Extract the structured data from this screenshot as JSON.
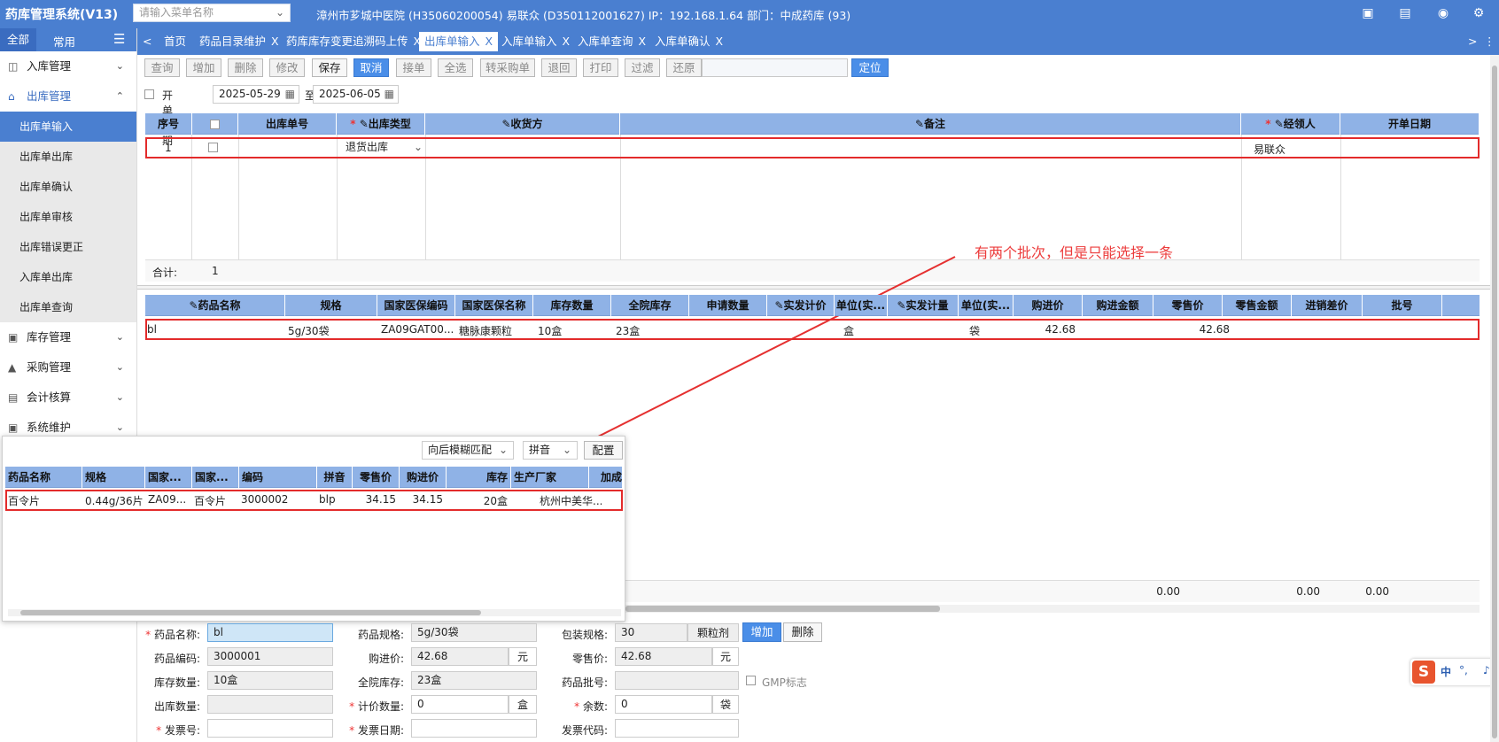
{
  "app_title": "药库管理系统(V13)",
  "menu_search": {
    "placeholder": "请输入菜单名称"
  },
  "system_info": "漳州市芗城中医院 (H35060200054) 易联众 (D350112001627) IP：192.168.1.64 部门：中成药库 (93)",
  "top_icons": [
    "monitor-icon",
    "document-icon",
    "eye-icon",
    "gear-icon"
  ],
  "nav_tabs": [
    "全部",
    "常用"
  ],
  "sidebar": {
    "groups": [
      {
        "label": "入库管理",
        "icon": "inbound-icon",
        "expanded": false
      },
      {
        "label": "出库管理",
        "icon": "outbound-icon",
        "expanded": true
      }
    ],
    "subitems": [
      "出库单输入",
      "出库单出库",
      "出库单确认",
      "出库单审核",
      "出库错误更正",
      "入库单出库",
      "出库单查询"
    ],
    "groups_after": [
      {
        "label": "库存管理",
        "icon": "stock-icon"
      },
      {
        "label": "采购管理",
        "icon": "purchase-icon"
      },
      {
        "label": "会计核算",
        "icon": "accounting-icon"
      },
      {
        "label": "系统维护",
        "icon": "system-icon"
      }
    ]
  },
  "tabs": [
    "首页",
    "药品目录维护",
    "药库库存变更追溯码上传",
    "出库单输入",
    "入库单输入",
    "入库单查询",
    "入库单确认"
  ],
  "active_tab": "出库单输入",
  "toolbar": [
    "查询",
    "增加",
    "删除",
    "修改",
    "保存",
    "取消",
    "接单",
    "全选",
    "转采购单",
    "退回",
    "打印",
    "过滤",
    "还原"
  ],
  "toolbar_enabled": [
    "保存"
  ],
  "toolbar_primary": "取消",
  "locate_button": "定位",
  "date_filter": {
    "label": "开单日期",
    "from": "2025-05-29",
    "sep": "至",
    "to": "2025-06-05"
  },
  "top_grid": {
    "headers": [
      "序号",
      "",
      "出库单号",
      "出库类型",
      "收货方",
      "备注",
      "经领人",
      "开单日期"
    ],
    "row": {
      "seq": "1",
      "type": "退货出库",
      "handler": "易联众"
    },
    "total_label": "合计:",
    "total_value": "1"
  },
  "annotation": "有两个批次，但是只能选择一条",
  "detail_grid": {
    "headers": [
      "药品名称",
      "规格",
      "国家医保编码",
      "国家医保名称",
      "库存数量",
      "全院库存",
      "申请数量",
      "实发计价",
      "单位(实...",
      "实发计量",
      "单位(实...",
      "购进价",
      "购进金额",
      "零售价",
      "零售金额",
      "进销差价",
      "批号"
    ],
    "row": [
      "bl",
      "5g/30袋",
      "ZA09GAT00...",
      "糖脉康颗粒",
      "10盒",
      "23盒",
      "",
      "",
      "盒",
      "",
      "袋",
      "42.68",
      "",
      "42.68",
      "",
      "",
      ""
    ],
    "totals": {
      "purchase_amount": "0.00",
      "retail_amount": "0.00",
      "diff": "0.00"
    }
  },
  "popup": {
    "match_mode": "向后模糊匹配",
    "input_mode": "拼音",
    "config_button": "配置",
    "headers": [
      "药品名称",
      "规格",
      "国家...",
      "国家...",
      "编码",
      "拼音",
      "零售价",
      "购进价",
      "库存",
      "生产厂家",
      "加成"
    ],
    "row": [
      "百令片",
      "0.44g/36片",
      "ZA09...",
      "百令片",
      "3000002",
      "blp",
      "34.15",
      "34.15",
      "20盒",
      "杭州中美华..."
    ]
  },
  "form": {
    "drug_name": {
      "label": "药品名称",
      "value": "bl"
    },
    "spec": {
      "label": "药品规格",
      "value": "5g/30袋"
    },
    "package": {
      "label": "包装规格",
      "value": "30",
      "unit": "颗粒剂"
    },
    "code": {
      "label": "药品编码",
      "value": "3000001"
    },
    "purchase_price": {
      "label": "购进价",
      "value": "42.68",
      "unit": "元"
    },
    "retail_price": {
      "label": "零售价",
      "value": "42.68",
      "unit": "元"
    },
    "stock_qty": {
      "label": "库存数量",
      "value": "10盒"
    },
    "hospital_stock": {
      "label": "全院库存",
      "value": "23盒"
    },
    "batch": {
      "label": "药品批号",
      "value": ""
    },
    "gmp": "GMP标志",
    "out_qty": {
      "label": "出库数量",
      "value": ""
    },
    "pricing_qty": {
      "label": "计价数量",
      "value": "0",
      "unit": "盒"
    },
    "remainder": {
      "label": "余数",
      "value": "0",
      "unit": "袋"
    },
    "invoice_no": {
      "label": "发票号",
      "value": ""
    },
    "invoice_date": {
      "label": "发票日期",
      "value": ""
    },
    "invoice_code": {
      "label": "发票代码",
      "value": ""
    },
    "add_button": "增加",
    "delete_button": "删除"
  },
  "ime": {
    "label": "中",
    "punct": "°,"
  }
}
